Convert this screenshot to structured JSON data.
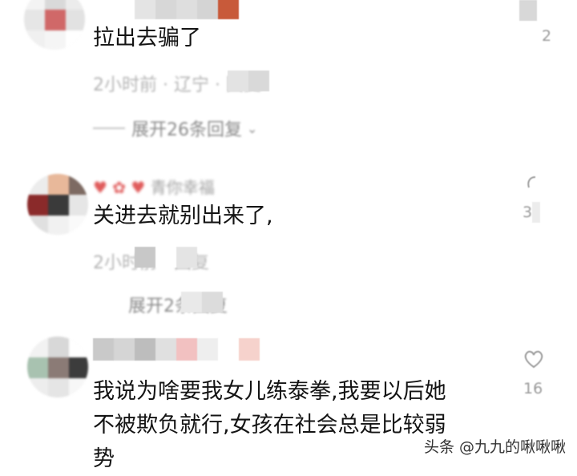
{
  "comments": [
    {
      "nickname": "",
      "text": "拉出去骗了",
      "meta": "2小时前 · 辽宁 · 回复",
      "expand_label": "展开26条回复",
      "like_count": "2"
    },
    {
      "nickname": "青你幸福",
      "text": "关进去就别出来了,",
      "meta": "2小时前 · 回复",
      "expand_label": "展开2条回复",
      "like_count": "3"
    },
    {
      "nickname": "",
      "text": "我说为啥要我女儿练泰拳,我要以后她\n不被欺负就行,女孩在社会总是比较弱\n势",
      "meta": "",
      "expand_label": "",
      "like_count": "16"
    }
  ],
  "watermark": "头条 @九九的啾啾啾",
  "colors": {
    "text": "#141414",
    "meta": "#b4b4b4",
    "background": "#ffffff"
  },
  "icons": {
    "like": "heart-outline-icon"
  }
}
